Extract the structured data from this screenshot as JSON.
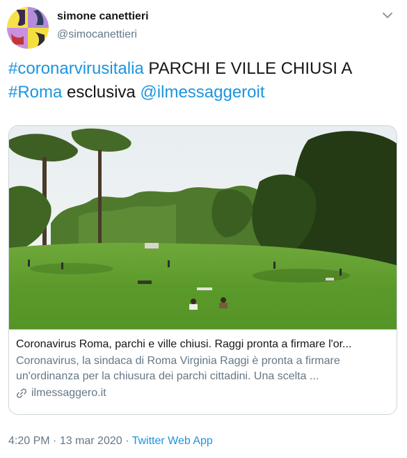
{
  "author": {
    "display_name": "simone canettieri",
    "handle": "@simocanettieri"
  },
  "icons": {
    "avatar": "avatar-quadrants-icon",
    "menu": "chevron-down-icon",
    "link": "link-icon"
  },
  "tweet": {
    "hashtag1": "#coronarvirusitalia",
    "text1": " PARCHI E VILLE CHIUSI A ",
    "hashtag2": "#Roma",
    "text2": " esclusiva ",
    "mention": "@ilmessaggeroit"
  },
  "card": {
    "title": "Coronavirus Roma, parchi e ville chiusi. Raggi pronta a firmare l'or...",
    "description_line1": "Coronavirus, la sindaca di Roma Virginia Raggi è pronta a firmare",
    "description_line2": "un'ordinanza per la chiusura dei parchi cittadini. Una scelta ...",
    "domain": "ilmessaggero.it"
  },
  "meta": {
    "time": "4:20 PM",
    "separator1": " · ",
    "date": "13 mar 2020",
    "separator2": " · ",
    "source": "Twitter Web App"
  },
  "colors": {
    "link": "#1b95e0",
    "secondary_text": "#657786",
    "border": "#ccd6dd"
  }
}
